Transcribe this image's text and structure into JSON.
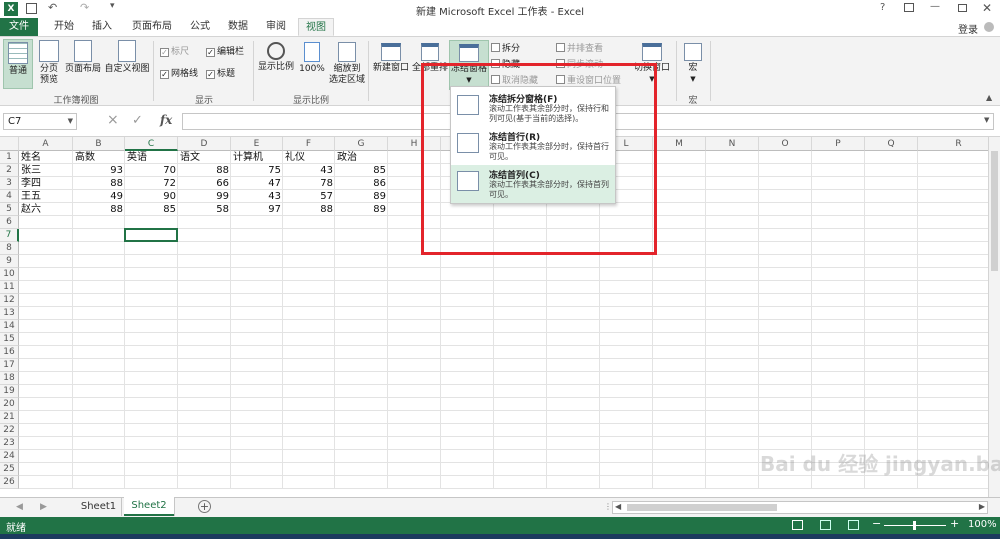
{
  "window": {
    "title": "新建 Microsoft Excel 工作表 - Excel",
    "login": "登录"
  },
  "tabs": [
    "文件",
    "开始",
    "插入",
    "页面布局",
    "公式",
    "数据",
    "审阅",
    "视图"
  ],
  "ribbon": {
    "workbook_views": {
      "normal": "普通",
      "page_break_1": "分页",
      "page_break_2": "预览",
      "page_layout": "页面布局",
      "custom_views": "自定义视图",
      "label": "工作簿视图"
    },
    "show": {
      "ruler": "标尺",
      "formula_bar": "编辑栏",
      "gridlines": "网格线",
      "headings": "标题",
      "label": "显示"
    },
    "zoom": {
      "zoom": "显示比例",
      "hundred": "100%",
      "zoom_to_sel_1": "缩放到",
      "zoom_to_sel_2": "选定区域",
      "label": "显示比例"
    },
    "window": {
      "new_window": "新建窗口",
      "arrange_all": "全部重排",
      "freeze_panes": "冻结窗格",
      "split": "拆分",
      "hide": "隐藏",
      "unhide": "取消隐藏",
      "side_by_side": "并排查看",
      "sync_scroll": "同步滚动",
      "reset_pos": "重设窗口位置",
      "switch": "切换窗口"
    },
    "macros": {
      "macros": "宏",
      "label": "宏"
    }
  },
  "name_box": "C7",
  "formula_icons": {
    "cancel": "×",
    "enter": "✓",
    "fx": "fx"
  },
  "columns": [
    "A",
    "B",
    "C",
    "D",
    "E",
    "F",
    "G",
    "H",
    "I",
    "J",
    "K",
    "L",
    "M",
    "N",
    "O",
    "P",
    "Q",
    "R"
  ],
  "rows": [
    "1",
    "2",
    "3",
    "4",
    "5",
    "6",
    "7",
    "8",
    "9",
    "10",
    "11",
    "12",
    "13",
    "14",
    "15",
    "16",
    "17",
    "18",
    "19",
    "20",
    "21",
    "22",
    "23",
    "24",
    "25",
    "26"
  ],
  "table": {
    "headers": [
      "姓名",
      "高数",
      "英语",
      "语文",
      "计算机",
      "礼仪",
      "政治"
    ],
    "data": [
      [
        "张三",
        "93",
        "70",
        "88",
        "75",
        "43",
        "85"
      ],
      [
        "李四",
        "88",
        "72",
        "66",
        "47",
        "78",
        "86"
      ],
      [
        "王五",
        "49",
        "90",
        "99",
        "43",
        "57",
        "89"
      ],
      [
        "赵六",
        "88",
        "85",
        "58",
        "97",
        "88",
        "89"
      ]
    ]
  },
  "freeze_menu": [
    {
      "title": "冻结拆分窗格(F)",
      "desc": "滚动工作表其余部分时，保持行和列可见(基于当前的选择)。"
    },
    {
      "title": "冻结首行(R)",
      "desc": "滚动工作表其余部分时，保持首行可见。"
    },
    {
      "title": "冻结首列(C)",
      "desc": "滚动工作表其余部分时，保持首列可见。"
    }
  ],
  "sheets": [
    "Sheet1",
    "Sheet2"
  ],
  "active_sheet": "Sheet2",
  "status": {
    "ready": "就绪",
    "zoom": "100%"
  },
  "accent": "#217346",
  "highlight_color": "#e3242b",
  "watermark": "Bai du 经验 jingyan.baidu.com"
}
